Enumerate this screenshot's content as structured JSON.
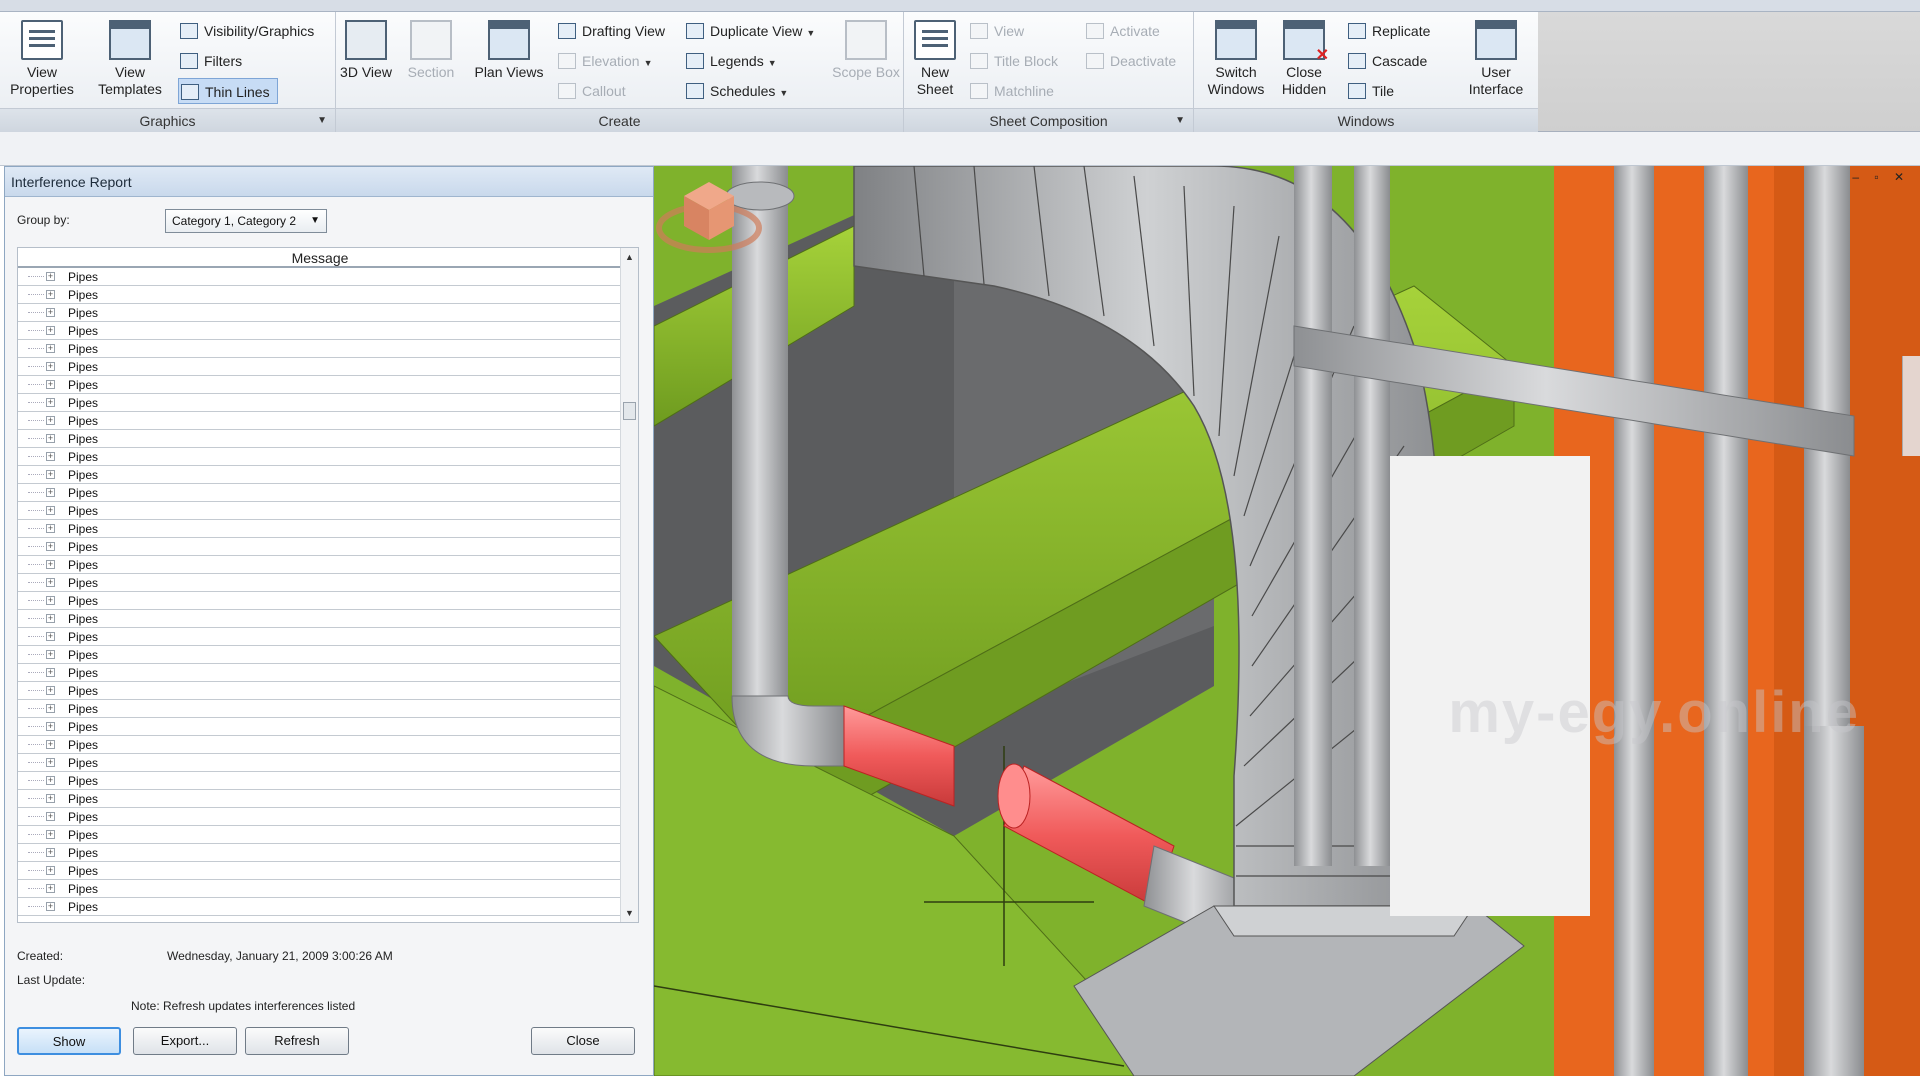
{
  "ribbon": {
    "groups": {
      "graphics": "Graphics",
      "create": "Create",
      "sheet_composition": "Sheet Composition",
      "windows": "Windows"
    },
    "buttons": {
      "view_properties": "View Properties",
      "view_templates": "View Templates",
      "visibility_graphics": "Visibility/Graphics",
      "filters": "Filters",
      "thin_lines": "Thin Lines",
      "view_3d": "3D View",
      "section": "Section",
      "plan_views": "Plan Views",
      "drafting_view": "Drafting View",
      "elevation": "Elevation",
      "callout": "Callout",
      "duplicate_view": "Duplicate View",
      "legends": "Legends",
      "schedules": "Schedules",
      "scope_box": "Scope Box",
      "new_sheet": "New Sheet",
      "view": "View",
      "title_block": "Title Block",
      "matchline": "Matchline",
      "activate": "Activate",
      "deactivate": "Deactivate",
      "switch_windows": "Switch Windows",
      "close_hidden": "Close Hidden",
      "replicate": "Replicate",
      "cascade": "Cascade",
      "tile": "Tile",
      "user_interface": "User Interface"
    }
  },
  "dialog": {
    "title": "Interference Report",
    "group_by_label": "Group by:",
    "group_by_value": "Category 1, Category 2",
    "column_header": "Message",
    "rows": [
      "Pipes",
      "Pipes",
      "Pipes",
      "Pipes",
      "Pipes",
      "Pipes",
      "Pipes",
      "Pipes",
      "Pipes",
      "Pipes",
      "Pipes",
      "Pipes",
      "Pipes",
      "Pipes",
      "Pipes",
      "Pipes",
      "Pipes",
      "Pipes",
      "Pipes",
      "Pipes",
      "Pipes",
      "Pipes",
      "Pipes",
      "Pipes",
      "Pipes",
      "Pipes",
      "Pipes",
      "Pipes",
      "Pipes",
      "Pipes",
      "Pipes",
      "Pipes",
      "Pipes",
      "Pipes",
      "Pipes",
      "Pipes"
    ],
    "created_label": "Created:",
    "created_value": "Wednesday, January 21, 2009 3:00:26 AM",
    "last_update_label": "Last Update:",
    "note": "Note: Refresh updates interferences listed",
    "buttons": {
      "show": "Show",
      "export": "Export...",
      "refresh": "Refresh",
      "close": "Close"
    }
  },
  "viewport": {
    "window_controls": "– ▫ ✕",
    "watermark_text": "my-egy.online"
  },
  "colors": {
    "floor_green": "#7fb22c",
    "clash_red": "#f26060",
    "wall_orange": "#e8661e",
    "duct_grey": "#b9bbbe"
  }
}
